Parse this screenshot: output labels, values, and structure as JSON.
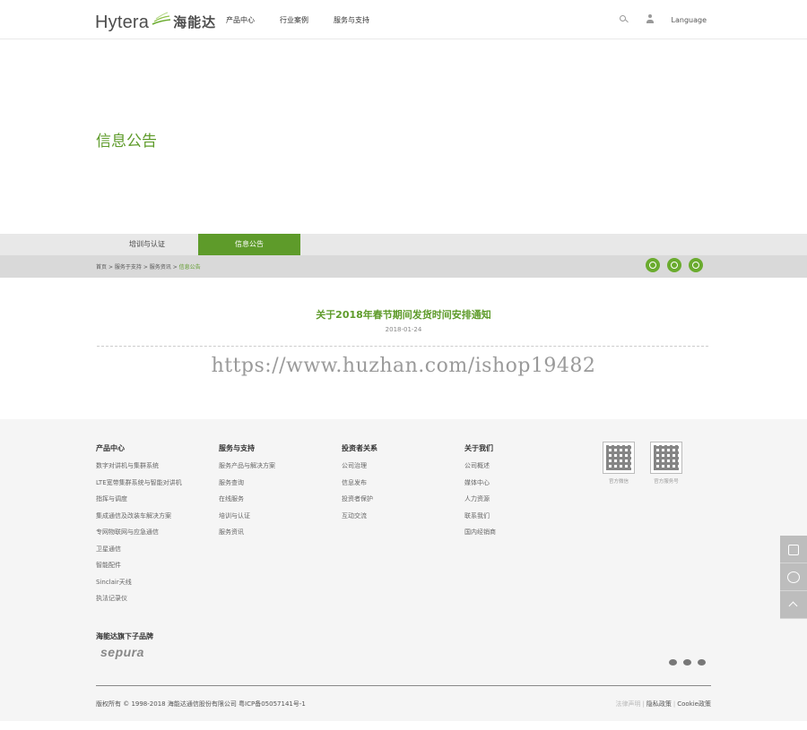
{
  "header": {
    "logo_en": "Hytera",
    "logo_cn": "海能达",
    "nav": [
      "产品中心",
      "行业案例",
      "服务与支持"
    ],
    "language_label": "Language"
  },
  "banner": {
    "title": "信息公告"
  },
  "tabs": [
    {
      "label": "培训与认证",
      "active": false
    },
    {
      "label": "信息公告",
      "active": true
    }
  ],
  "breadcrumb": {
    "items": [
      "首页",
      "服务于支持",
      "服务资讯"
    ],
    "separator": ">",
    "current": "信息公告"
  },
  "article": {
    "title": "关于2018年春节期间发货时间安排通知",
    "date": "2018-01-24"
  },
  "watermark": "https://www.huzhan.com/ishop19482",
  "footer": {
    "columns": [
      {
        "heading": "产品中心",
        "items": [
          "数字对讲机与集群系统",
          "LTE宽带集群系统与智能对讲机",
          "指挥与调度",
          "集成通信及改装车解决方案",
          "专网物联网与应急通信",
          "卫星通信",
          "智能配件",
          "Sinclair天线",
          "执法记录仪"
        ]
      },
      {
        "heading": "服务与支持",
        "items": [
          "服务产品与解决方案",
          "服务查询",
          "在线服务",
          "培训与认证",
          "服务资讯"
        ]
      },
      {
        "heading": "投资者关系",
        "items": [
          "公司治理",
          "信息发布",
          "投资者保护",
          "互动交流"
        ]
      },
      {
        "heading": "关于我们",
        "items": [
          "公司概述",
          "媒体中心",
          "人力资源",
          "联系我们",
          "国内经销商"
        ]
      }
    ],
    "qr_codes": [
      {
        "label": "官方微信"
      },
      {
        "label": "官方服务号"
      }
    ],
    "brands_title": "海能达旗下子品牌",
    "brand_logo": "sepura",
    "copyright": "版权所有 © 1998-2018 海能达通信股份有限公司 粤ICP备05057141号-1",
    "legal": {
      "disclaimer": "法律声明",
      "privacy": "隐私政策",
      "cookie": "Cookie政策",
      "separator": "|"
    }
  },
  "colors": {
    "brand_green": "#5e9b2a",
    "icon_green": "#6aab2e"
  }
}
